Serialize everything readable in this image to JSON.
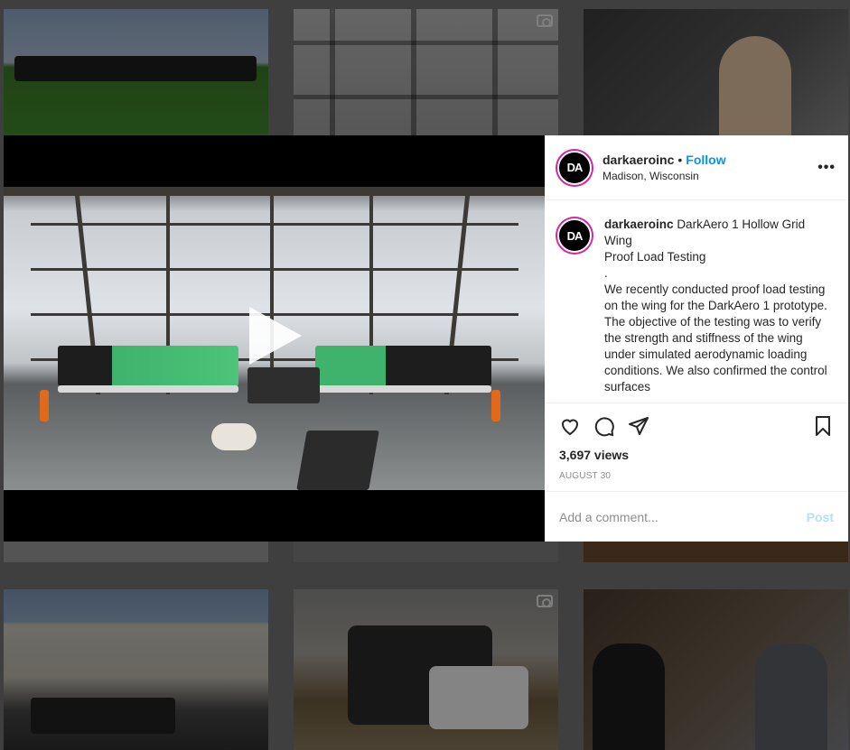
{
  "post": {
    "account": {
      "username": "darkaeroinc",
      "avatar_text": "DA",
      "location": "Madison, Wisconsin",
      "follow_label": "Follow",
      "separator": "•",
      "more_label": "•••"
    },
    "caption": {
      "username": "darkaeroinc",
      "lines": [
        "DarkAero 1 Hollow Grid Wing",
        "Proof Load Testing",
        ".",
        "We recently conducted proof load testing on the wing for the DarkAero 1 prototype. The objective of the testing was to verify the strength and stiffness of the wing under simulated aerodynamic loading conditions. We also confirmed the control surfaces"
      ]
    },
    "actions": {
      "like_icon": "heart-icon",
      "comment_icon": "comment-icon",
      "share_icon": "paper-plane-icon",
      "save_icon": "bookmark-icon"
    },
    "views": "3,697 views",
    "date": "AUGUST 30",
    "comment": {
      "placeholder": "Add a comment...",
      "post_label": "Post"
    }
  },
  "colors": {
    "follow": "#0095f6",
    "post_disabled": "#b2dffc",
    "avatar_ring": "#d6249f"
  }
}
